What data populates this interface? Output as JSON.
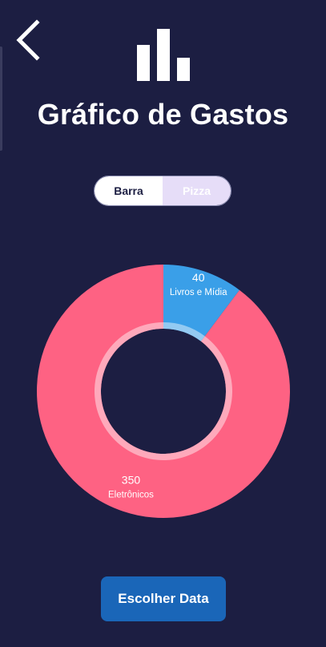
{
  "header": {
    "back_icon": "chevron-left-icon",
    "chart_icon": "bar-chart-icon",
    "title": "Gráfico de Gastos"
  },
  "toggle": {
    "options": [
      "Barra",
      "Pizza"
    ],
    "selected": "Pizza"
  },
  "chart_data": {
    "type": "pie",
    "donut": true,
    "slices": [
      {
        "label": "Livros e Mídia",
        "value": 40,
        "color": "#3a9fe8"
      },
      {
        "label": "Eletrônicos",
        "value": 350,
        "color": "#fe6283"
      }
    ]
  },
  "footer": {
    "choose_date_label": "Escolher Data"
  },
  "colors": {
    "background": "#1c1e42",
    "button": "#1a66b8"
  }
}
